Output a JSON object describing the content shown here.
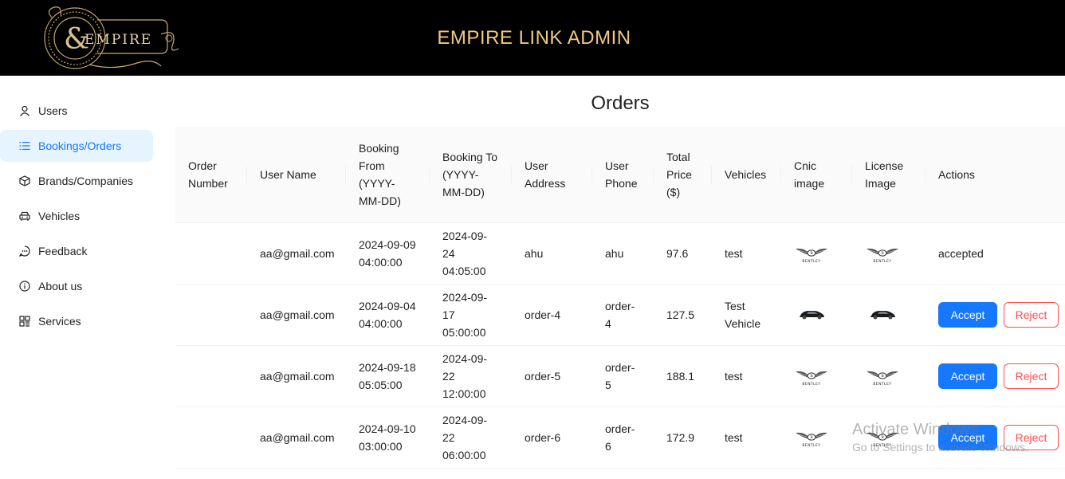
{
  "header": {
    "title": "EMPIRE LINK ADMIN",
    "logo_text": "EMPIRE"
  },
  "sidebar": {
    "items": [
      {
        "label": "Users",
        "icon": "user-icon"
      },
      {
        "label": "Bookings/Orders",
        "icon": "list-icon",
        "active": true
      },
      {
        "label": "Brands/Companies",
        "icon": "cube-icon"
      },
      {
        "label": "Vehicles",
        "icon": "car-icon"
      },
      {
        "label": "Feedback",
        "icon": "chat-icon"
      },
      {
        "label": "About us",
        "icon": "info-icon"
      },
      {
        "label": "Services",
        "icon": "grid-icon"
      }
    ]
  },
  "page": {
    "title": "Orders"
  },
  "table": {
    "columns": [
      "Order Number",
      "User Name",
      "Booking From (YYYY-MM-DD)",
      "Booking To (YYYY-MM-DD)",
      "User Address",
      "User Phone",
      "Total Price ($)",
      "Vehicles",
      "Cnic image",
      "License Image",
      "Actions"
    ],
    "rows": [
      {
        "order_number": "",
        "user_name": "aa@gmail.com",
        "booking_from": "2024-09-09 04:00:00",
        "booking_to": "2024-09-24 04:05:00",
        "address": "ahu",
        "phone": "ahu",
        "price": "97.6",
        "vehicles": "test",
        "cnic_image": "bentley-logo",
        "license_image": "bentley-logo",
        "status": "accepted"
      },
      {
        "order_number": "",
        "user_name": "aa@gmail.com",
        "booking_from": "2024-09-04 04:00:00",
        "booking_to": "2024-09-17 05:00:00",
        "address": "order-4",
        "phone": "order-4",
        "price": "127.5",
        "vehicles": "Test Vehicle",
        "cnic_image": "car-photo",
        "license_image": "car-photo",
        "status": ""
      },
      {
        "order_number": "",
        "user_name": "aa@gmail.com",
        "booking_from": "2024-09-18 05:05:00",
        "booking_to": "2024-09-22 12:00:00",
        "address": "order-5",
        "phone": "order-5",
        "price": "188.1",
        "vehicles": "test",
        "cnic_image": "bentley-logo",
        "license_image": "bentley-logo",
        "status": ""
      },
      {
        "order_number": "",
        "user_name": "aa@gmail.com",
        "booking_from": "2024-09-10 03:00:00",
        "booking_to": "2024-09-22 06:00:00",
        "address": "order-6",
        "phone": "order-6",
        "price": "172.9",
        "vehicles": "test",
        "cnic_image": "bentley-logo",
        "license_image": "bentley-logo",
        "status": ""
      }
    ],
    "accept_label": "Accept",
    "reject_label": "Reject",
    "bentley_text": "BENTLEY"
  },
  "watermark": {
    "title": "Activate Windows",
    "subtitle": "Go to Settings to activate Windows."
  },
  "colors": {
    "header_bg": "#000000",
    "title_gold": "#f0c983",
    "primary": "#1677ff",
    "danger": "#ff4d4f",
    "active_bg": "#e6f4ff"
  }
}
